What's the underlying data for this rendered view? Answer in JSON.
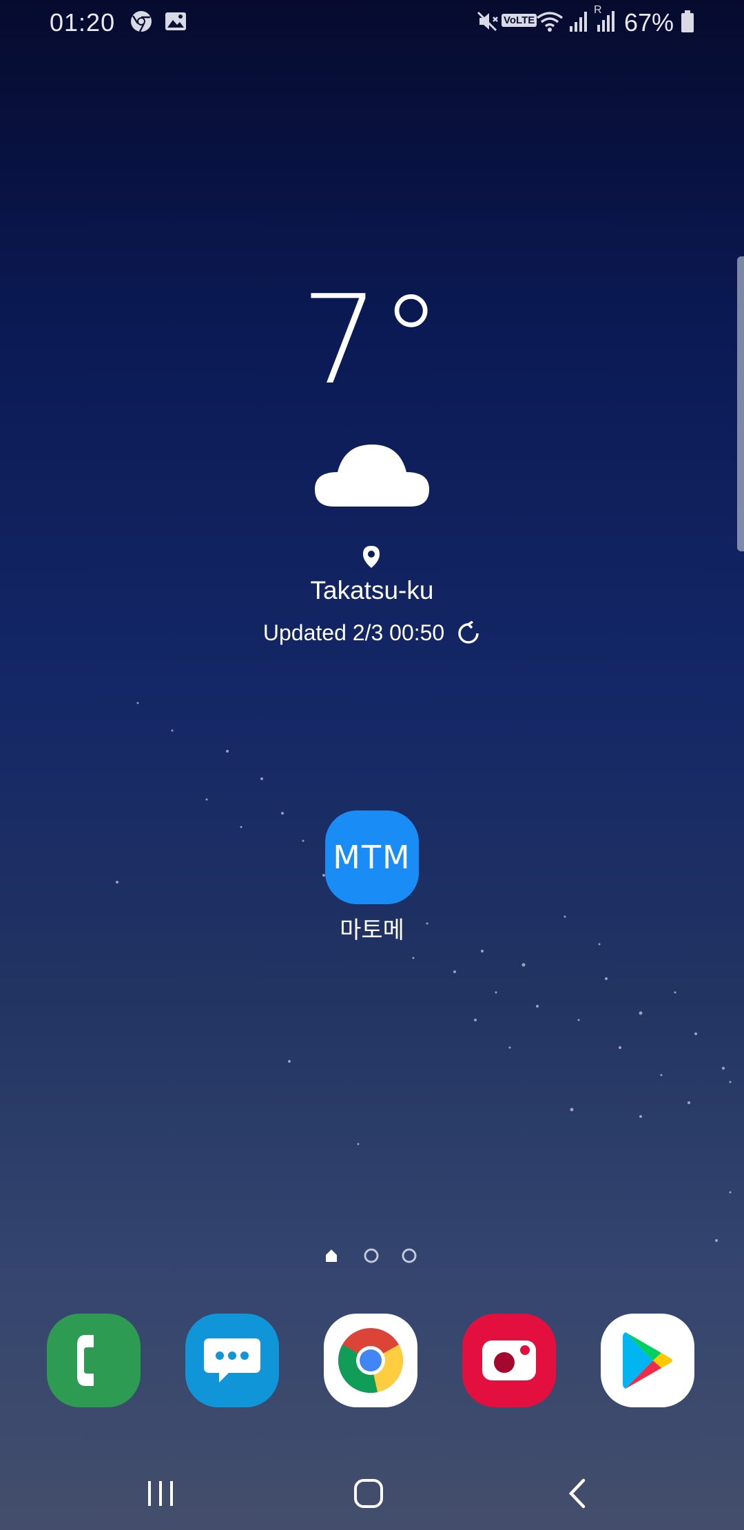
{
  "status_bar": {
    "time": "01:20",
    "battery_percent": "67%",
    "volte_label": "VoLTE",
    "roaming_label": "R",
    "icons": [
      "chrome-icon",
      "gallery-icon",
      "vibrate-mute-icon",
      "volte-icon",
      "wifi-icon",
      "signal-icon",
      "roaming-signal-icon",
      "battery-icon"
    ]
  },
  "weather": {
    "temperature": "7°",
    "condition_icon": "cloud-icon",
    "location": "Takatsu-ku",
    "updated": "Updated 2/3 00:50"
  },
  "home_apps": [
    {
      "icon_text": "MTM",
      "label": "마토메",
      "color": "#1a8cf6"
    }
  ],
  "page_indicator": {
    "pages": 3,
    "current": 0
  },
  "dock": [
    "phone-app-icon",
    "messages-app-icon",
    "chrome-app-icon",
    "camera-app-icon",
    "play-store-app-icon"
  ],
  "colors": {
    "phone": "#2e9b52",
    "messages": "#0f95d8",
    "camera": "#e3103f",
    "mtm": "#1a8cf6"
  }
}
